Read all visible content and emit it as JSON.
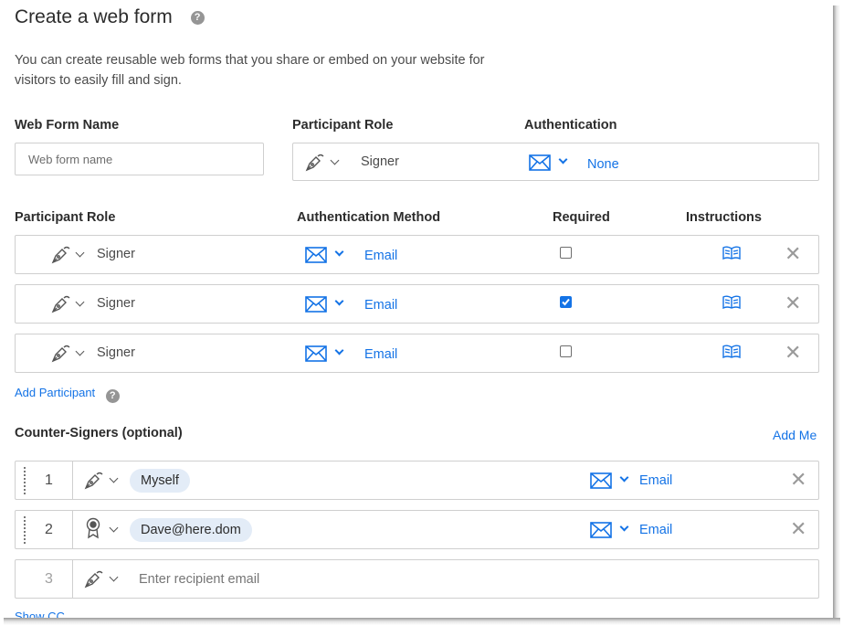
{
  "title": "Create a web form",
  "description": "You can create reusable web forms that you share or embed on your website for visitors to easily fill and sign.",
  "web_form_name": {
    "label": "Web Form Name",
    "placeholder": "Web form name"
  },
  "top_role": {
    "label": "Participant Role",
    "value": "Signer"
  },
  "top_auth": {
    "label": "Authentication",
    "value": "None"
  },
  "table": {
    "headers": [
      "Participant Role",
      "Authentication Method",
      "Required",
      "Instructions"
    ],
    "rows": [
      {
        "role": "Signer",
        "auth": "Email",
        "required": false
      },
      {
        "role": "Signer",
        "auth": "Email",
        "required": true
      },
      {
        "role": "Signer",
        "auth": "Email",
        "required": false
      }
    ]
  },
  "add_participant": "Add Participant",
  "counter_signers": {
    "label": "Counter-Signers (optional)",
    "add_me": "Add Me",
    "rows": [
      {
        "index": "1",
        "role_icon": "pen-icon",
        "recipient": "Myself",
        "auth": "Email"
      },
      {
        "index": "2",
        "role_icon": "award-icon",
        "recipient": "Dave@here.dom",
        "auth": "Email"
      },
      {
        "index": "3",
        "role_icon": "pen-icon",
        "placeholder": "Enter recipient email"
      }
    ]
  },
  "show_cc": "Show CC",
  "colors": {
    "accent": "#1473e6",
    "text": "#2c2c2c",
    "border": "#cfcfcf",
    "pill": "#e3ecf7"
  }
}
